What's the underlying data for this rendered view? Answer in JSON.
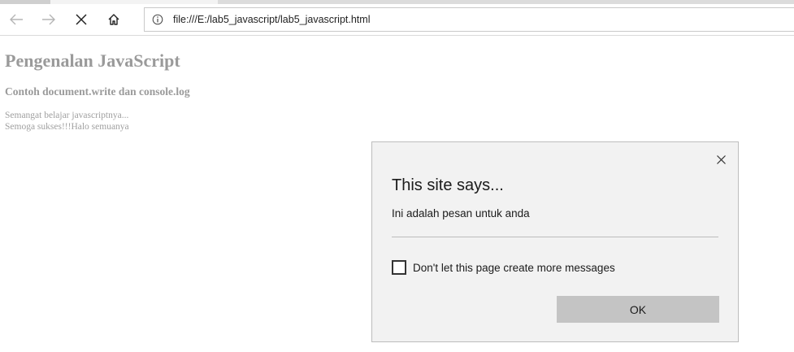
{
  "browser": {
    "url": "file:///E:/lab5_javascript/lab5_javascript.html"
  },
  "page": {
    "heading": "Pengenalan JavaScript",
    "subheading": "Contoh document.write dan console.log",
    "output_lines": [
      "Semangat belajar javascriptnya...",
      "Semoga sukses!!!Halo semuanya"
    ]
  },
  "dialog": {
    "title": "This site says...",
    "message": "Ini adalah pesan untuk anda",
    "checkbox_label": "Don't let this page create more messages",
    "checkbox_checked": false,
    "ok_label": "OK"
  },
  "icons": {
    "back": "back-arrow-icon",
    "forward": "forward-arrow-icon",
    "stop": "close-x-icon",
    "home": "home-icon",
    "info": "info-icon",
    "dialog_close": "close-icon"
  },
  "colors": {
    "dialog_bg": "#f2f2f2",
    "ok_button_bg": "#c4c4c4",
    "page_text": "#9a9a9a"
  }
}
